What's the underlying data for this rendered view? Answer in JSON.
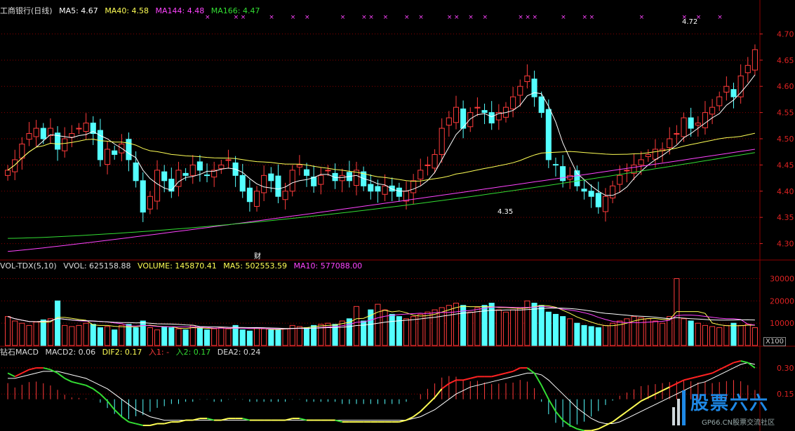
{
  "header": {
    "stock_title": "工商银行(日线)",
    "ma5": "MA5: 4.67",
    "ma40": "MA40: 4.58",
    "ma144": "MA144: 4.48",
    "ma166": "MA166: 4.47"
  },
  "volume_header": {
    "name": "VOL-TDX(5,10)",
    "vvol": "VVOL: 625158.88",
    "volume": "VOLUME: 145870.41",
    "ma5": "MA5: 502553.59",
    "ma10": "MA10: 577088.00"
  },
  "macd_header": {
    "name": "钻石MACD",
    "macd2": "MACD2: 0.06",
    "dif2": "DIF2: 0.17",
    "ru1": "入1: -",
    "ru2": "入2: 0.17",
    "dea2": "DEA2: 0.24"
  },
  "annotations": {
    "high_label": "4.72",
    "low_label": "4.35",
    "finance_marker": "财",
    "volume_unit": "X100"
  },
  "watermark": {
    "title": "股票六六",
    "subtitle": "GP66.CN股票交流社区"
  },
  "colors": {
    "up": "#ff3b3b",
    "down": "#54ffff",
    "ma5": "#ffffff",
    "ma40": "#ffff55",
    "ma144": "#ff44ff",
    "ma166": "#33dd33",
    "axis_text": "#dd2222",
    "grid": "#8b0000"
  },
  "chart_data": [
    {
      "type": "candlestick",
      "title": "工商银行(日线)",
      "ylim": [
        4.27,
        4.73
      ],
      "yticks": [
        4.3,
        4.35,
        4.4,
        4.45,
        4.5,
        4.55,
        4.6,
        4.65,
        4.7
      ],
      "ytick_labels": [
        "4.30",
        "4.35",
        "4.40",
        "4.45",
        "4.50",
        "4.55",
        "4.60",
        "4.65",
        "4.70"
      ],
      "x_count": 106,
      "series_close": [
        4.44,
        4.46,
        4.49,
        4.51,
        4.52,
        4.5,
        4.52,
        4.48,
        4.5,
        4.51,
        4.52,
        4.53,
        4.51,
        4.46,
        4.48,
        4.47,
        4.49,
        4.46,
        4.42,
        4.36,
        4.39,
        4.44,
        4.42,
        4.4,
        4.44,
        4.43,
        4.45,
        4.44,
        4.43,
        4.44,
        4.45,
        4.46,
        4.43,
        4.4,
        4.38,
        4.4,
        4.43,
        4.42,
        4.39,
        4.4,
        4.44,
        4.45,
        4.43,
        4.41,
        4.43,
        4.44,
        4.42,
        4.43,
        4.42,
        4.44,
        4.41,
        4.4,
        4.4,
        4.41,
        4.4,
        4.39,
        4.4,
        4.42,
        4.44,
        4.45,
        4.47,
        4.52,
        4.54,
        4.56,
        4.52,
        4.55,
        4.56,
        4.55,
        4.53,
        4.55,
        4.56,
        4.58,
        4.6,
        4.62,
        4.58,
        4.55,
        4.46,
        4.45,
        4.42,
        4.43,
        4.41,
        4.4,
        4.39,
        4.37,
        4.39,
        4.41,
        4.43,
        4.44,
        4.45,
        4.46,
        4.47,
        4.48,
        4.48,
        4.5,
        4.51,
        4.54,
        4.52,
        4.53,
        4.55,
        4.56,
        4.58,
        4.6,
        4.58,
        4.62,
        4.64,
        4.67
      ],
      "open_close_pairs_note": "",
      "high_marker": 4.72,
      "low_marker": 4.35
    },
    {
      "type": "bar",
      "title": "VOL-TDX(5,10)",
      "ylim": [
        0,
        33000
      ],
      "yticks": [
        10000,
        20000,
        30000
      ],
      "ytick_labels": [
        "10000",
        "20000",
        "30000"
      ],
      "values": [
        13000,
        11000,
        10000,
        9000,
        10500,
        11500,
        12000,
        20000,
        9000,
        8500,
        9000,
        10000,
        9500,
        8000,
        8500,
        7000,
        9000,
        9500,
        8000,
        11000,
        8000,
        7000,
        8500,
        8000,
        7500,
        7000,
        9000,
        8000,
        7000,
        7500,
        8000,
        7500,
        9000,
        7000,
        6500,
        8000,
        7500,
        7000,
        7000,
        7500,
        9000,
        8500,
        8000,
        9000,
        9500,
        10000,
        9500,
        11000,
        12000,
        17500,
        11000,
        16000,
        18500,
        16000,
        14000,
        13000,
        12000,
        13000,
        14000,
        15000,
        16000,
        17000,
        18000,
        19000,
        18000,
        15000,
        17000,
        18000,
        19000,
        16000,
        15000,
        16000,
        17000,
        20000,
        19000,
        18000,
        15000,
        14000,
        13000,
        12000,
        10000,
        9000,
        8500,
        8000,
        9000,
        10000,
        11000,
        12000,
        13000,
        12500,
        12000,
        11000,
        10000,
        13000,
        30000,
        12000,
        11000,
        10000,
        9000,
        8500,
        8000,
        9000,
        10000,
        9000,
        9500,
        8000
      ],
      "series": [
        {
          "name": "MA5",
          "values": []
        },
        {
          "name": "MA10",
          "values": []
        }
      ]
    },
    {
      "type": "bar",
      "title": "钻石MACD",
      "ylim": [
        -0.05,
        0.36
      ],
      "yticks": [
        0.15,
        0.3
      ],
      "ytick_labels": [
        "0.15",
        "0.30"
      ],
      "dif": [
        0.27,
        0.25,
        0.27,
        0.29,
        0.3,
        0.3,
        0.29,
        0.27,
        0.24,
        0.22,
        0.21,
        0.2,
        0.18,
        0.15,
        0.11,
        0.06,
        0.02,
        -0.01,
        -0.02,
        -0.03,
        -0.03,
        -0.02,
        -0.02,
        -0.01,
        -0.01,
        0.0,
        0.0,
        0.01,
        0.01,
        0.0,
        0.0,
        0.01,
        0.01,
        0.01,
        0.0,
        0.0,
        0.0,
        0.0,
        0.0,
        0.0,
        0.01,
        0.01,
        0.0,
        0.0,
        0.0,
        0.0,
        0.0,
        -0.01,
        -0.01,
        -0.01,
        -0.01,
        -0.01,
        -0.01,
        -0.01,
        -0.01,
        -0.01,
        0.0,
        0.02,
        0.05,
        0.09,
        0.13,
        0.18,
        0.21,
        0.23,
        0.23,
        0.24,
        0.25,
        0.25,
        0.25,
        0.26,
        0.27,
        0.28,
        0.3,
        0.3,
        0.27,
        0.2,
        0.12,
        0.05,
        0.0,
        -0.03,
        -0.05,
        -0.06,
        -0.06,
        -0.05,
        -0.03,
        -0.01,
        0.02,
        0.05,
        0.08,
        0.11,
        0.13,
        0.15,
        0.17,
        0.19,
        0.21,
        0.23,
        0.24,
        0.25,
        0.26,
        0.27,
        0.29,
        0.31,
        0.33,
        0.34,
        0.33,
        0.3
      ],
      "dea": [
        0.24,
        0.24,
        0.25,
        0.26,
        0.27,
        0.28,
        0.28,
        0.28,
        0.27,
        0.26,
        0.25,
        0.24,
        0.22,
        0.2,
        0.18,
        0.15,
        0.12,
        0.09,
        0.06,
        0.04,
        0.02,
        0.01,
        0.0,
        0.0,
        0.0,
        0.0,
        0.0,
        0.0,
        0.0,
        0.0,
        0.0,
        0.0,
        0.0,
        0.0,
        0.0,
        0.0,
        0.0,
        0.0,
        0.0,
        0.0,
        0.0,
        0.0,
        0.0,
        0.0,
        0.0,
        0.0,
        0.0,
        0.0,
        0.0,
        0.0,
        0.0,
        0.0,
        0.0,
        0.0,
        0.0,
        0.0,
        0.0,
        0.01,
        0.02,
        0.04,
        0.06,
        0.09,
        0.12,
        0.15,
        0.17,
        0.19,
        0.2,
        0.21,
        0.22,
        0.23,
        0.24,
        0.25,
        0.26,
        0.27,
        0.27,
        0.26,
        0.23,
        0.19,
        0.15,
        0.11,
        0.07,
        0.04,
        0.01,
        -0.01,
        -0.02,
        -0.02,
        -0.01,
        0.01,
        0.03,
        0.05,
        0.07,
        0.09,
        0.11,
        0.13,
        0.15,
        0.17,
        0.19,
        0.21,
        0.22,
        0.24,
        0.26,
        0.28,
        0.3,
        0.32,
        0.33,
        0.32
      ]
    }
  ]
}
